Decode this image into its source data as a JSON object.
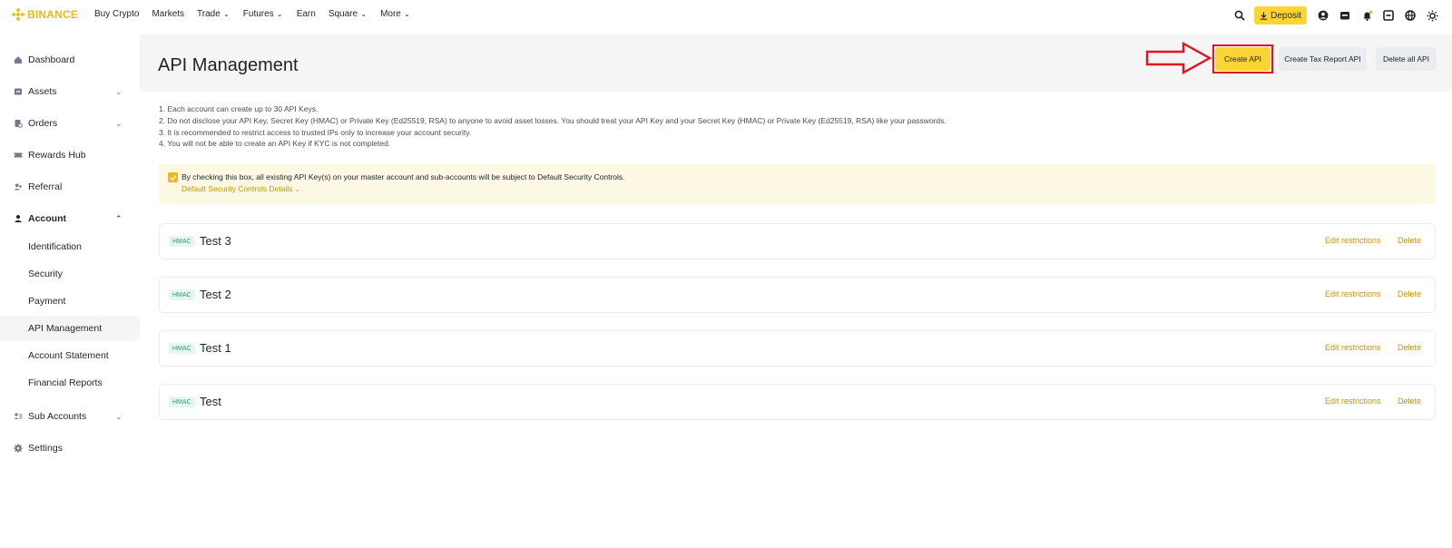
{
  "brand": {
    "name": "BINANCE",
    "color": "#F0B90B"
  },
  "nav": {
    "links": [
      {
        "label": "Buy Crypto",
        "dropdown": false
      },
      {
        "label": "Markets",
        "dropdown": false
      },
      {
        "label": "Trade",
        "dropdown": true
      },
      {
        "label": "Futures",
        "dropdown": true
      },
      {
        "label": "Earn",
        "dropdown": false
      },
      {
        "label": "Square",
        "dropdown": true
      },
      {
        "label": "More",
        "dropdown": true
      }
    ],
    "deposit_label": "Deposit",
    "right_icons": [
      "search-icon",
      "user-icon",
      "wallet-icon",
      "bell-icon",
      "scan-icon",
      "globe-icon",
      "theme-icon"
    ]
  },
  "sidebar": {
    "items": [
      {
        "label": "Dashboard",
        "icon": "home-icon"
      },
      {
        "label": "Assets",
        "icon": "wallet-icon",
        "expandable": true
      },
      {
        "label": "Orders",
        "icon": "orders-icon",
        "expandable": true
      },
      {
        "label": "Rewards Hub",
        "icon": "ticket-icon"
      },
      {
        "label": "Referral",
        "icon": "user-plus-icon"
      },
      {
        "label": "Account",
        "icon": "person-icon",
        "expanded": true
      }
    ],
    "account_sub": [
      {
        "label": "Identification"
      },
      {
        "label": "Security"
      },
      {
        "label": "Payment"
      },
      {
        "label": "API Management",
        "active": true
      },
      {
        "label": "Account Statement"
      },
      {
        "label": "Financial Reports"
      }
    ],
    "bottom": [
      {
        "label": "Sub Accounts",
        "icon": "sub-accounts-icon",
        "expandable": true
      },
      {
        "label": "Settings",
        "icon": "gear-icon"
      }
    ]
  },
  "page": {
    "title": "API Management",
    "buttons": {
      "create": "Create API",
      "tax": "Create Tax Report API",
      "delete_all": "Delete all API"
    },
    "info_lines": [
      "1. Each account can create up to 30 API Keys.",
      "2. Do not disclose your API Key, Secret Key (HMAC) or Private Key (Ed25519, RSA) to anyone to avoid asset losses. You should treat your API Key and your Secret Key (HMAC) or Private Key (Ed25519, RSA) like your passwords.",
      "3. It is recommended to restrict access to trusted IPs only to increase your account security.",
      "4. You will not be able to create an API Key if KYC is not completed."
    ],
    "notice": {
      "checked": true,
      "text": "By checking this box, all existing API Key(s) on your master account and sub-accounts will be subject to Default Security Controls.",
      "link": "Default Security Controls Details"
    },
    "api_keys": [
      {
        "type": "HMAC",
        "name": "Test 3",
        "edit": "Edit restrictions",
        "delete": "Delete"
      },
      {
        "type": "HMAC",
        "name": "Test 2",
        "edit": "Edit restrictions",
        "delete": "Delete"
      },
      {
        "type": "HMAC",
        "name": "Test 1",
        "edit": "Edit restrictions",
        "delete": "Delete"
      },
      {
        "type": "HMAC",
        "name": "Test",
        "edit": "Edit restrictions",
        "delete": "Delete"
      }
    ]
  },
  "colors": {
    "accent": "#FCD535",
    "link": "#C99400",
    "annotation": "#E3141F"
  }
}
